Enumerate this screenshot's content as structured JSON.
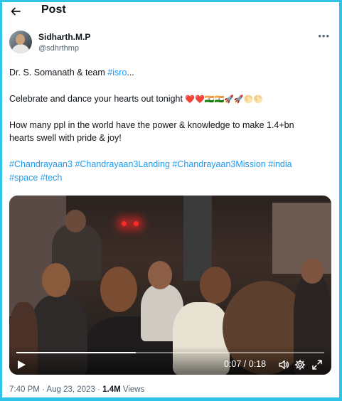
{
  "header": {
    "title": "Post",
    "back_icon": "arrow-left-icon"
  },
  "author": {
    "display_name": "Sidharth.M.P",
    "handle": "@sdhrthmp"
  },
  "tweet": {
    "line1_prefix": "Dr. S. Somanath & team ",
    "line1_link": "#isro",
    "line1_suffix": "...",
    "line2_text": "Celebrate and dance your hearts out tonight ",
    "line2_emojis": "❤️❤️🇮🇳🇮🇳🚀🚀🌕🌕",
    "line3": "How many ppl in the world have the power & knowledge to make 1.4+bn",
    "line4": "hearts swell with pride & joy!",
    "hashtags": [
      "#Chandrayaan3",
      "#Chandrayaan3Landing",
      "#Chandrayaan3Mission",
      "#india",
      "#space",
      "#tech"
    ]
  },
  "video": {
    "elapsed": "0:07",
    "duration": "0:18",
    "time_label": "0:07 / 0:18",
    "progress": 0.389
  },
  "footer": {
    "time": "7:40 PM",
    "sep1": " · ",
    "date": "Aug 23, 2023",
    "sep2": " · ",
    "views_count": "1.4M",
    "views_label": " Views"
  },
  "colors": {
    "accent": "#1d9bf0",
    "frame_border": "#2ec4e8",
    "text": "#0f1419",
    "muted": "#536471"
  }
}
